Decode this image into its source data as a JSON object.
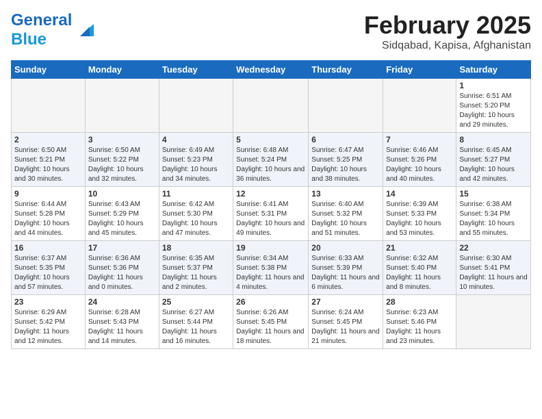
{
  "header": {
    "logo_general": "General",
    "logo_blue": "Blue",
    "title": "February 2025",
    "subtitle": "Sidqabad, Kapisa, Afghanistan"
  },
  "days_of_week": [
    "Sunday",
    "Monday",
    "Tuesday",
    "Wednesday",
    "Thursday",
    "Friday",
    "Saturday"
  ],
  "weeks": [
    [
      {
        "day": "",
        "info": ""
      },
      {
        "day": "",
        "info": ""
      },
      {
        "day": "",
        "info": ""
      },
      {
        "day": "",
        "info": ""
      },
      {
        "day": "",
        "info": ""
      },
      {
        "day": "",
        "info": ""
      },
      {
        "day": "1",
        "info": "Sunrise: 6:51 AM\nSunset: 5:20 PM\nDaylight: 10 hours and 29 minutes."
      }
    ],
    [
      {
        "day": "2",
        "info": "Sunrise: 6:50 AM\nSunset: 5:21 PM\nDaylight: 10 hours and 30 minutes."
      },
      {
        "day": "3",
        "info": "Sunrise: 6:50 AM\nSunset: 5:22 PM\nDaylight: 10 hours and 32 minutes."
      },
      {
        "day": "4",
        "info": "Sunrise: 6:49 AM\nSunset: 5:23 PM\nDaylight: 10 hours and 34 minutes."
      },
      {
        "day": "5",
        "info": "Sunrise: 6:48 AM\nSunset: 5:24 PM\nDaylight: 10 hours and 36 minutes."
      },
      {
        "day": "6",
        "info": "Sunrise: 6:47 AM\nSunset: 5:25 PM\nDaylight: 10 hours and 38 minutes."
      },
      {
        "day": "7",
        "info": "Sunrise: 6:46 AM\nSunset: 5:26 PM\nDaylight: 10 hours and 40 minutes."
      },
      {
        "day": "8",
        "info": "Sunrise: 6:45 AM\nSunset: 5:27 PM\nDaylight: 10 hours and 42 minutes."
      }
    ],
    [
      {
        "day": "9",
        "info": "Sunrise: 6:44 AM\nSunset: 5:28 PM\nDaylight: 10 hours and 44 minutes."
      },
      {
        "day": "10",
        "info": "Sunrise: 6:43 AM\nSunset: 5:29 PM\nDaylight: 10 hours and 45 minutes."
      },
      {
        "day": "11",
        "info": "Sunrise: 6:42 AM\nSunset: 5:30 PM\nDaylight: 10 hours and 47 minutes."
      },
      {
        "day": "12",
        "info": "Sunrise: 6:41 AM\nSunset: 5:31 PM\nDaylight: 10 hours and 49 minutes."
      },
      {
        "day": "13",
        "info": "Sunrise: 6:40 AM\nSunset: 5:32 PM\nDaylight: 10 hours and 51 minutes."
      },
      {
        "day": "14",
        "info": "Sunrise: 6:39 AM\nSunset: 5:33 PM\nDaylight: 10 hours and 53 minutes."
      },
      {
        "day": "15",
        "info": "Sunrise: 6:38 AM\nSunset: 5:34 PM\nDaylight: 10 hours and 55 minutes."
      }
    ],
    [
      {
        "day": "16",
        "info": "Sunrise: 6:37 AM\nSunset: 5:35 PM\nDaylight: 10 hours and 57 minutes."
      },
      {
        "day": "17",
        "info": "Sunrise: 6:36 AM\nSunset: 5:36 PM\nDaylight: 11 hours and 0 minutes."
      },
      {
        "day": "18",
        "info": "Sunrise: 6:35 AM\nSunset: 5:37 PM\nDaylight: 11 hours and 2 minutes."
      },
      {
        "day": "19",
        "info": "Sunrise: 6:34 AM\nSunset: 5:38 PM\nDaylight: 11 hours and 4 minutes."
      },
      {
        "day": "20",
        "info": "Sunrise: 6:33 AM\nSunset: 5:39 PM\nDaylight: 11 hours and 6 minutes."
      },
      {
        "day": "21",
        "info": "Sunrise: 6:32 AM\nSunset: 5:40 PM\nDaylight: 11 hours and 8 minutes."
      },
      {
        "day": "22",
        "info": "Sunrise: 6:30 AM\nSunset: 5:41 PM\nDaylight: 11 hours and 10 minutes."
      }
    ],
    [
      {
        "day": "23",
        "info": "Sunrise: 6:29 AM\nSunset: 5:42 PM\nDaylight: 11 hours and 12 minutes."
      },
      {
        "day": "24",
        "info": "Sunrise: 6:28 AM\nSunset: 5:43 PM\nDaylight: 11 hours and 14 minutes."
      },
      {
        "day": "25",
        "info": "Sunrise: 6:27 AM\nSunset: 5:44 PM\nDaylight: 11 hours and 16 minutes."
      },
      {
        "day": "26",
        "info": "Sunrise: 6:26 AM\nSunset: 5:45 PM\nDaylight: 11 hours and 18 minutes."
      },
      {
        "day": "27",
        "info": "Sunrise: 6:24 AM\nSunset: 5:45 PM\nDaylight: 11 hours and 21 minutes."
      },
      {
        "day": "28",
        "info": "Sunrise: 6:23 AM\nSunset: 5:46 PM\nDaylight: 11 hours and 23 minutes."
      },
      {
        "day": "",
        "info": ""
      }
    ]
  ]
}
